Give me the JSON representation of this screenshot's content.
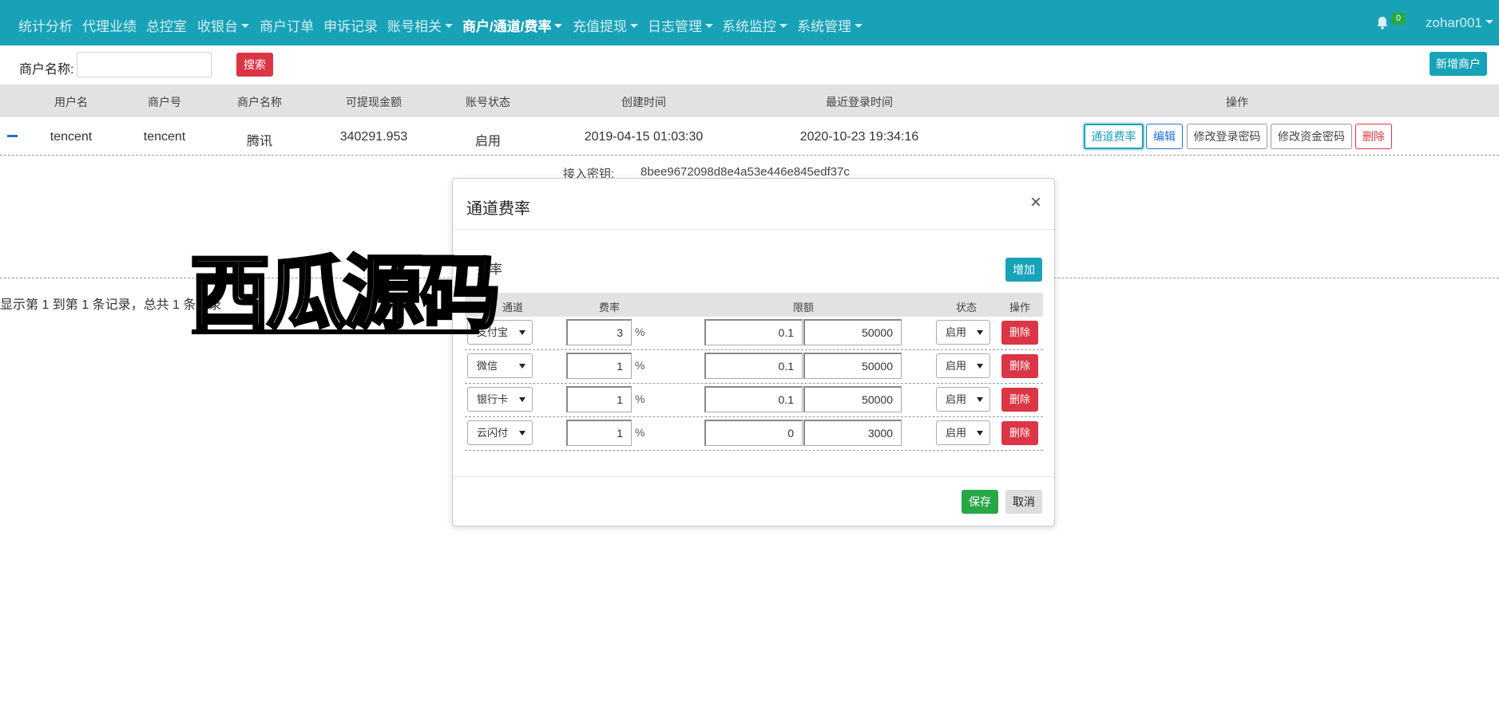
{
  "nav": {
    "items": [
      {
        "label": "统计分析",
        "dropdown": false
      },
      {
        "label": "代理业绩",
        "dropdown": false
      },
      {
        "label": "总控室",
        "dropdown": false
      },
      {
        "label": "收银台",
        "dropdown": true
      },
      {
        "label": "商户订单",
        "dropdown": false
      },
      {
        "label": "申诉记录",
        "dropdown": false
      },
      {
        "label": "账号相关",
        "dropdown": true
      },
      {
        "label": "商户/通道/费率",
        "dropdown": true,
        "active": true
      },
      {
        "label": "充值提现",
        "dropdown": true
      },
      {
        "label": "日志管理",
        "dropdown": true
      },
      {
        "label": "系统监控",
        "dropdown": true
      },
      {
        "label": "系统管理",
        "dropdown": true
      }
    ],
    "notification_count": "0",
    "user": "zohar001"
  },
  "search": {
    "label": "商户名称:",
    "value": "",
    "button": "搜索"
  },
  "add_merchant_button": "新增商户",
  "table": {
    "headers": [
      "用户名",
      "商户号",
      "商户名称",
      "可提现金额",
      "账号状态",
      "创建时间",
      "最近登录时间",
      "操作"
    ],
    "row": {
      "username": "tencent",
      "merchant_no": "tencent",
      "merchant_name": "腾讯",
      "withdrawable": "340291.953",
      "status": "启用",
      "created": "2019-04-15 01:03:30",
      "last_login": "2020-10-23 19:34:16"
    },
    "actions": [
      "通道费率",
      "编辑",
      "修改登录密码",
      "修改资金密码",
      "删除"
    ],
    "detail_label": "接入密钥:",
    "detail_value": "8bee9672098d8e4a53e446e845edf37c",
    "records_text": "显示第 1 到第 1 条记录，总共 1 条记录"
  },
  "watermark": "西瓜源码",
  "modal": {
    "title": "通道费率",
    "close": "×",
    "section": "费率",
    "add_button": "增加",
    "headers": [
      "通道",
      "费率",
      "限额",
      "状态",
      "操作"
    ],
    "rows": [
      {
        "channel": "支付宝",
        "rate": "3",
        "unit": "%",
        "min": "0.1",
        "max": "50000",
        "status": "启用",
        "delete": "删除"
      },
      {
        "channel": "微信",
        "rate": "1",
        "unit": "%",
        "min": "0.1",
        "max": "50000",
        "status": "启用",
        "delete": "删除"
      },
      {
        "channel": "银行卡",
        "rate": "1",
        "unit": "%",
        "min": "0.1",
        "max": "50000",
        "status": "启用",
        "delete": "删除"
      },
      {
        "channel": "云闪付",
        "rate": "1",
        "unit": "%",
        "min": "0",
        "max": "3000",
        "status": "启用",
        "delete": "删除"
      }
    ],
    "save": "保存",
    "cancel": "取消"
  },
  "colors": {
    "navbar": "#17a2b8",
    "danger": "#dc3545",
    "success": "#28a745",
    "primary": "#1f6fd6"
  }
}
